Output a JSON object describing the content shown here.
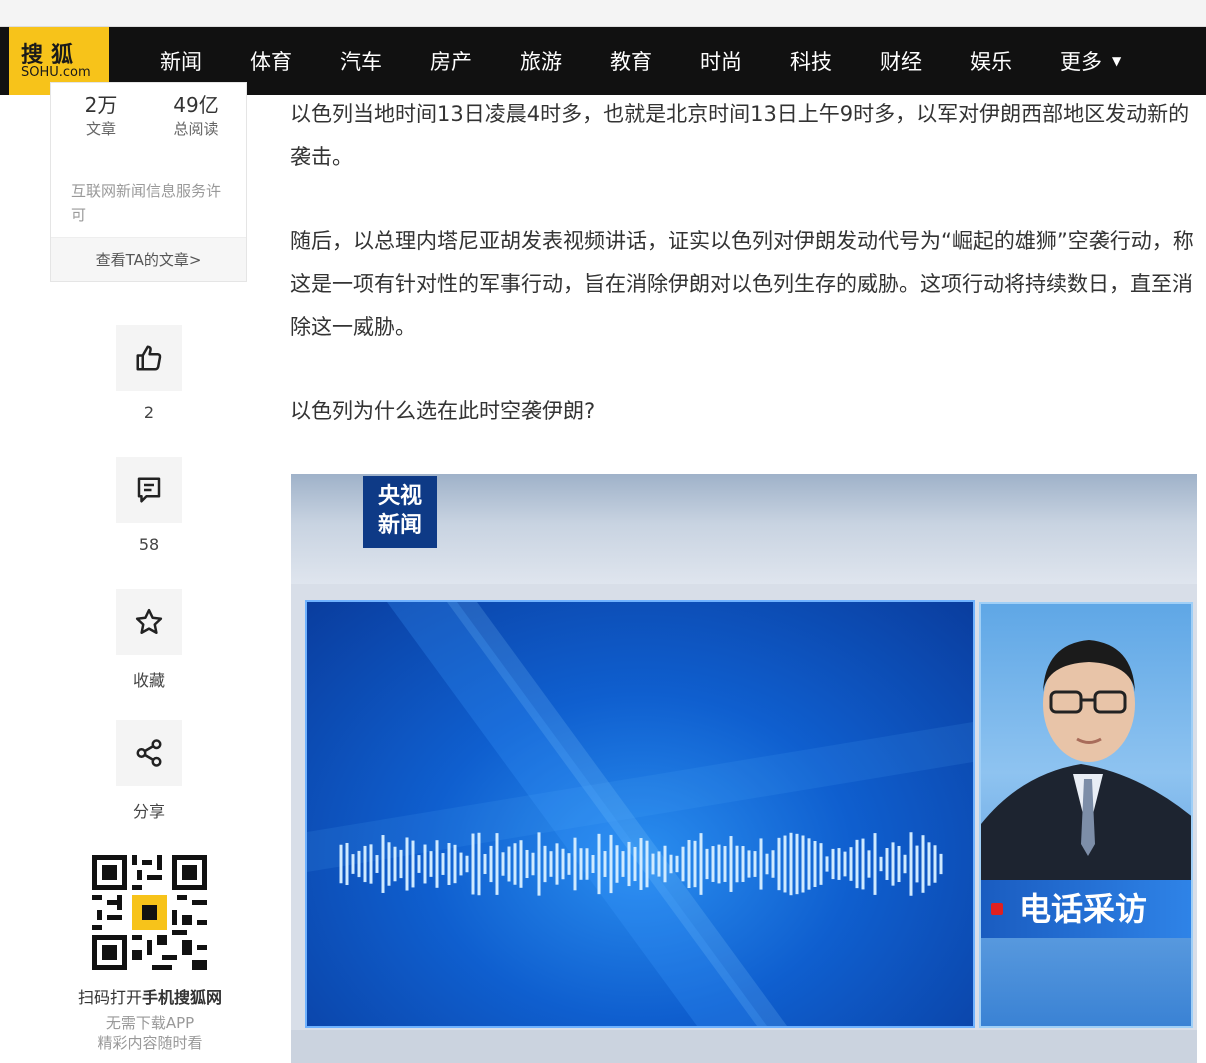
{
  "nav": {
    "logo_top": "搜狐",
    "logo_bottom": "SOHU.com",
    "items": [
      "新闻",
      "体育",
      "汽车",
      "房产",
      "旅游",
      "教育",
      "时尚",
      "科技",
      "财经",
      "娱乐"
    ],
    "more": "更多"
  },
  "author": {
    "articles_count": "2万",
    "articles_label": "文章",
    "reads_count": "49亿",
    "reads_label": "总阅读",
    "license": "互联网新闻信息服务许可",
    "see_articles": "查看TA的文章>"
  },
  "actions": {
    "like_count": "2",
    "comment_count": "58",
    "favorite_label": "收藏",
    "share_label": "分享"
  },
  "qr": {
    "caption_prefix": "扫码打开",
    "caption_bold": "手机搜狐网",
    "sub1": "无需下载APP",
    "sub2": "精彩内容随时看"
  },
  "article": {
    "p1": "以色列当地时间13日凌晨4时多，也就是北京时间13日上午9时多，以军对伊朗西部地区发动新的袭击。",
    "p2": "随后，以总理内塔尼亚胡发表视频讲话，证实以色列对伊朗发动代号为“崛起的雄狮”空袭行动，称这是一项有针对性的军事行动，旨在消除伊朗对以色列生存的威胁。这项行动将持续数日，直至消除这一威胁。",
    "p3": "以色列为什么选在此时空袭伊朗?"
  },
  "video": {
    "channel_line1": "央视",
    "channel_line2": "新闻",
    "phone_interview": "电话采访"
  },
  "colors": {
    "nav_bg": "#111111",
    "logo_bg": "#f7c31a",
    "cctv_blue": "#0e3a86"
  }
}
